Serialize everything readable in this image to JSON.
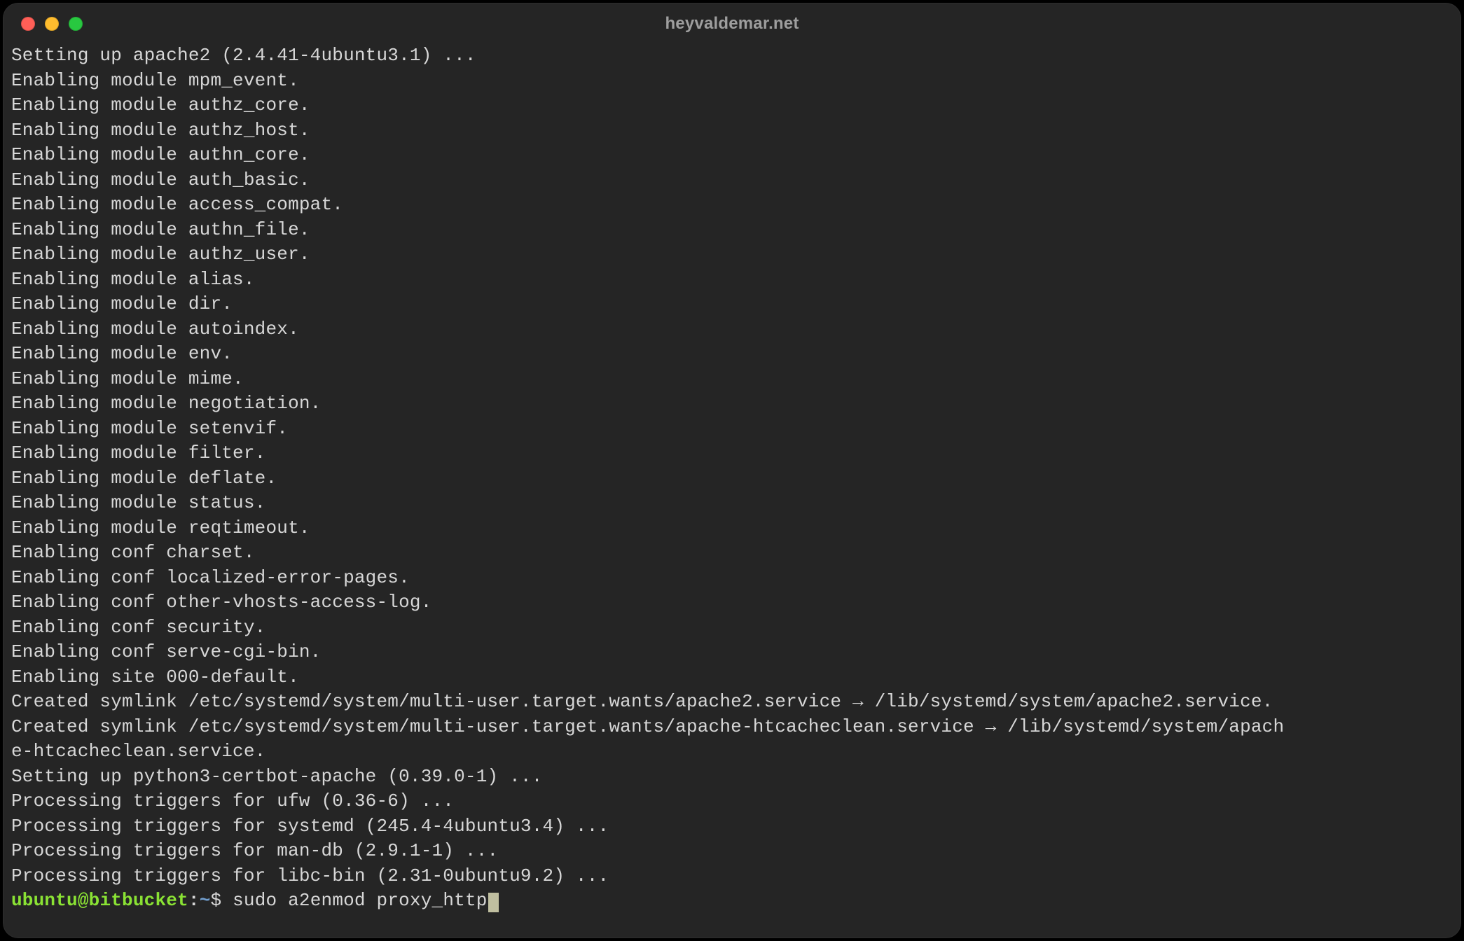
{
  "window": {
    "title": "heyvaldemar.net"
  },
  "terminal": {
    "lines": [
      "Setting up apache2 (2.4.41-4ubuntu3.1) ...",
      "Enabling module mpm_event.",
      "Enabling module authz_core.",
      "Enabling module authz_host.",
      "Enabling module authn_core.",
      "Enabling module auth_basic.",
      "Enabling module access_compat.",
      "Enabling module authn_file.",
      "Enabling module authz_user.",
      "Enabling module alias.",
      "Enabling module dir.",
      "Enabling module autoindex.",
      "Enabling module env.",
      "Enabling module mime.",
      "Enabling module negotiation.",
      "Enabling module setenvif.",
      "Enabling module filter.",
      "Enabling module deflate.",
      "Enabling module status.",
      "Enabling module reqtimeout.",
      "Enabling conf charset.",
      "Enabling conf localized-error-pages.",
      "Enabling conf other-vhosts-access-log.",
      "Enabling conf security.",
      "Enabling conf serve-cgi-bin.",
      "Enabling site 000-default.",
      "Created symlink /etc/systemd/system/multi-user.target.wants/apache2.service → /lib/systemd/system/apache2.service.",
      "Created symlink /etc/systemd/system/multi-user.target.wants/apache-htcacheclean.service → /lib/systemd/system/apach",
      "e-htcacheclean.service.",
      "Setting up python3-certbot-apache (0.39.0-1) ...",
      "Processing triggers for ufw (0.36-6) ...",
      "Processing triggers for systemd (245.4-4ubuntu3.4) ...",
      "Processing triggers for man-db (2.9.1-1) ...",
      "Processing triggers for libc-bin (2.31-0ubuntu9.2) ..."
    ],
    "prompt": {
      "user": "ubuntu",
      "at": "@",
      "host": "bitbucket",
      "colon": ":",
      "cwd": "~",
      "dollar": "$ ",
      "command": "sudo a2enmod proxy_http"
    }
  },
  "colors": {
    "background": "#252525",
    "foreground": "#d7d7d7",
    "prompt_user_host": "#8ae234",
    "prompt_cwd": "#729fcf",
    "traffic_red": "#ff5f57",
    "traffic_yellow": "#febc2e",
    "traffic_green": "#28c840"
  }
}
